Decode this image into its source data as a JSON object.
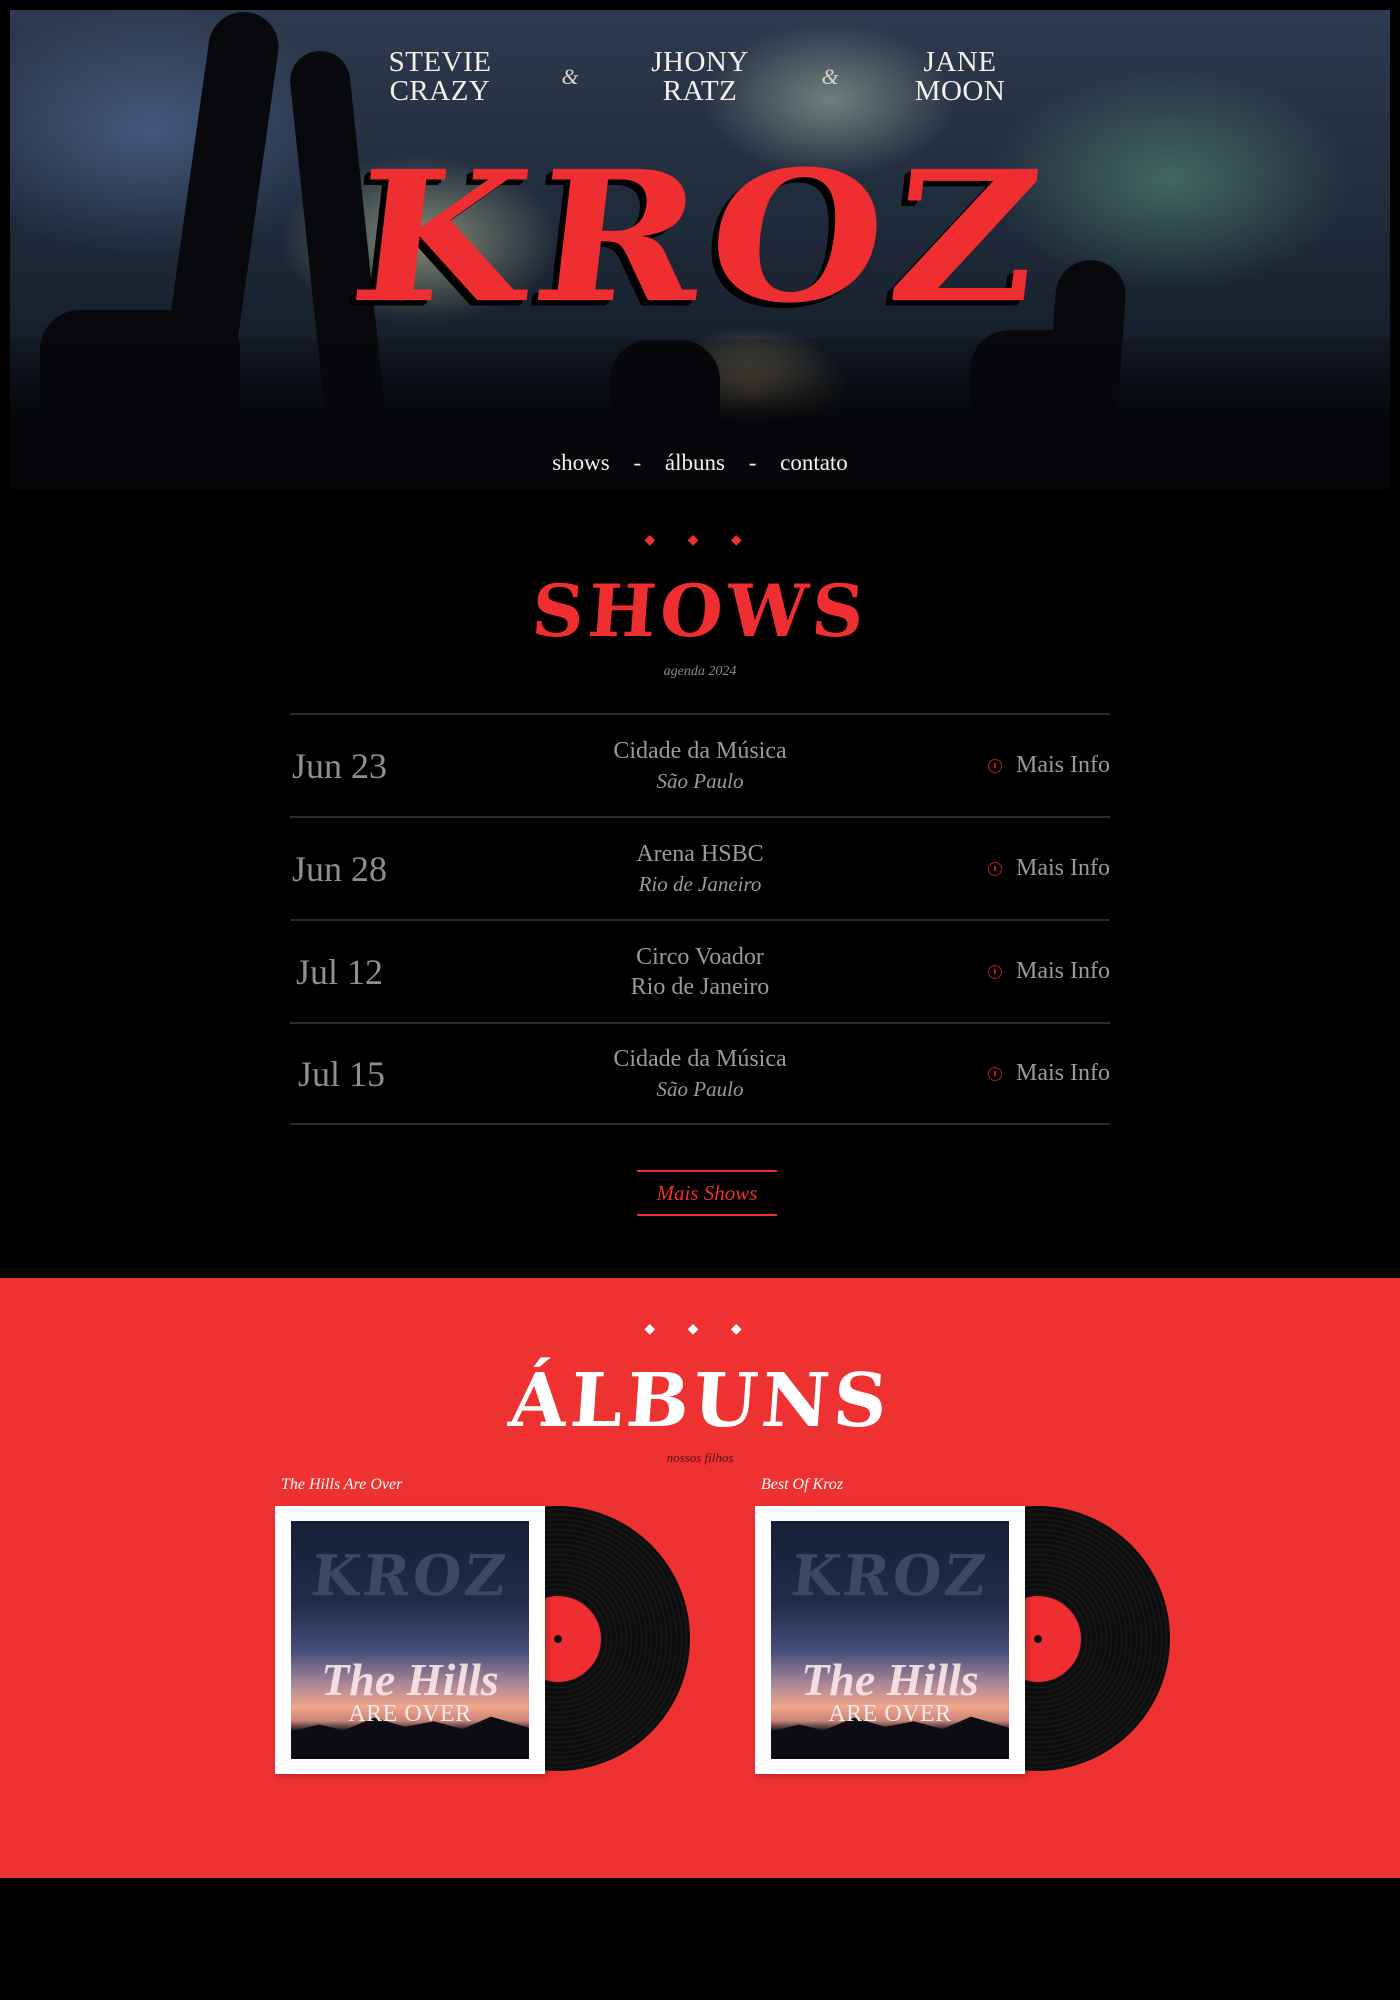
{
  "hero": {
    "members": [
      {
        "first": "STEVIE",
        "last": "CRAZY"
      },
      {
        "first": "JHONY",
        "last": "RATZ"
      },
      {
        "first": "JANE",
        "last": "MOON"
      }
    ],
    "ampersand": "&",
    "logo": "KROZ",
    "nav": {
      "shows": "shows",
      "albums": "álbuns",
      "contact": "contato",
      "separator": "-"
    }
  },
  "shows": {
    "ornament": "◆ ◆ ◆",
    "title": "SHOWS",
    "subtitle": "agenda 2024",
    "more_label": "Mais Info",
    "rows": [
      {
        "date": "Jun 23",
        "venue": "Cidade da Música",
        "city": "São Paulo"
      },
      {
        "date": "Jun 28",
        "venue": "Arena HSBC",
        "city": "Rio de Janeiro"
      },
      {
        "date": "Jul 12",
        "venue": "Circo Voador",
        "city": "Rio de Janeiro"
      },
      {
        "date": "Jul 15",
        "venue": "Cidade da Música",
        "city": "São Paulo"
      }
    ],
    "more_shows": "Mais Shows"
  },
  "albums": {
    "ornament": "◆ ◆ ◆",
    "title": "ÁLBUNS",
    "subtitle": "nossos filhos",
    "items": [
      {
        "label": "The Hills Are Over",
        "cover_logo": "KROZ",
        "cover_title": "The Hills",
        "cover_subtitle": "ARE OVER"
      },
      {
        "label": "Best Of Kroz",
        "cover_logo": "KROZ",
        "cover_title": "The Hills",
        "cover_subtitle": "ARE OVER"
      }
    ]
  },
  "colors": {
    "accent": "#ee2e31",
    "background": "#000000",
    "albums_bg": "#ee3131"
  }
}
